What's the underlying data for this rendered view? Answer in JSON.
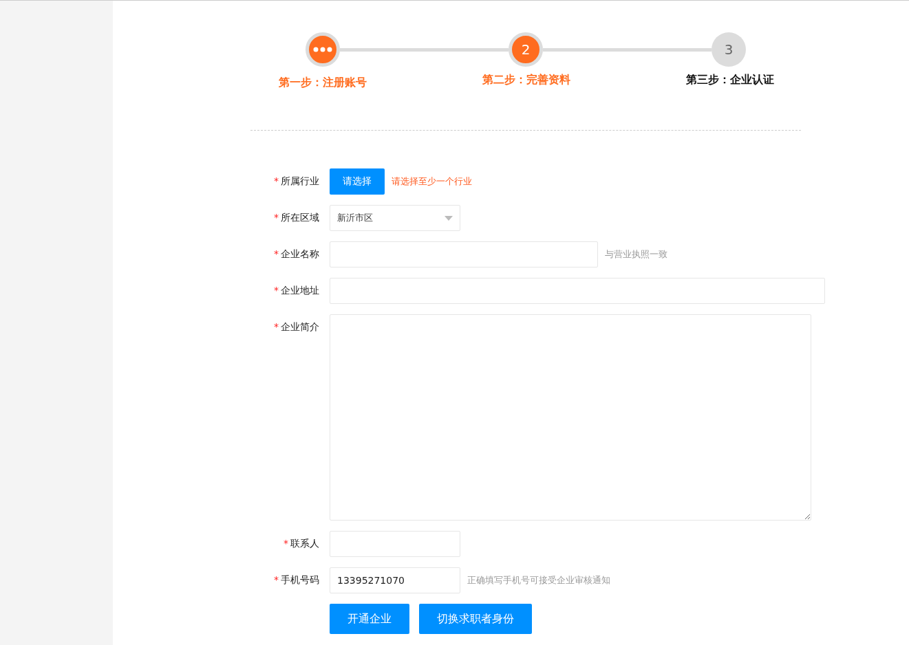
{
  "steps": [
    {
      "kind": "dots",
      "label": "第一步：注册账号",
      "active": true
    },
    {
      "kind": "number",
      "number": "2",
      "label": "第二步：完善资料",
      "active": true
    },
    {
      "kind": "number",
      "number": "3",
      "label": "第三步：企业认证",
      "active": false
    }
  ],
  "form": {
    "fields": [
      {
        "kind": "picker",
        "mark": "*",
        "label": "所属行业",
        "button": "请选择",
        "hint": "请选择至少一个行业"
      },
      {
        "kind": "select",
        "mark": "*",
        "label": "所在区域",
        "value": "新沂市区"
      },
      {
        "kind": "medium",
        "mark": "*",
        "label": "企业名称",
        "hint": "与营业执照一致"
      },
      {
        "kind": "wide",
        "mark": "*",
        "label": "企业地址"
      },
      {
        "kind": "textarea",
        "mark": "*",
        "label": "企业简介"
      },
      {
        "kind": "short",
        "mark": "*",
        "label": "联系人"
      },
      {
        "kind": "short",
        "mark": "*",
        "label": "手机号码",
        "value": "13395271070",
        "hint": "正确填写手机号可接受企业审核通知"
      }
    ],
    "buttons": [
      "开通企业",
      "切换求职者身份"
    ]
  }
}
